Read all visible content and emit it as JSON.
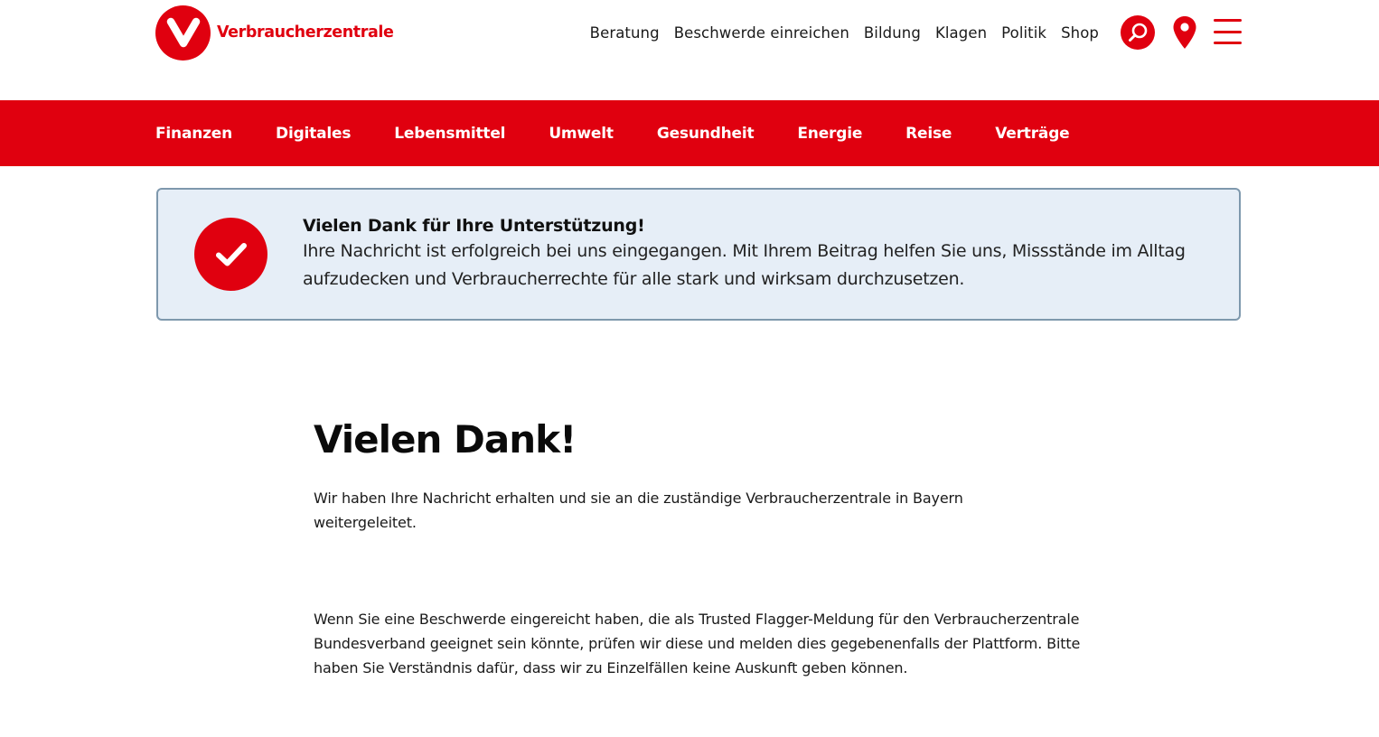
{
  "brand": {
    "name": "Verbraucherzentrale",
    "color": "#e0000f"
  },
  "topnav": {
    "items": [
      {
        "label": "Beratung"
      },
      {
        "label": "Beschwerde einreichen"
      },
      {
        "label": "Bildung"
      },
      {
        "label": "Klagen"
      },
      {
        "label": "Politik"
      },
      {
        "label": "Shop"
      }
    ],
    "icons": [
      "search-icon",
      "location-pin-icon",
      "menu-icon"
    ]
  },
  "catnav": {
    "items": [
      {
        "label": "Finanzen"
      },
      {
        "label": "Digitales"
      },
      {
        "label": "Lebensmittel"
      },
      {
        "label": "Umwelt"
      },
      {
        "label": "Gesundheit"
      },
      {
        "label": "Energie"
      },
      {
        "label": "Reise"
      },
      {
        "label": "Verträge"
      }
    ]
  },
  "notice": {
    "icon": "checkmark-icon",
    "title": "Vielen Dank für Ihre Unterstützung!",
    "body": "Ihre Nachricht ist erfolgreich bei uns eingegangen. Mit Ihrem Beitrag helfen Sie uns, Missstände im Alltag aufzudecken und Verbraucherrechte für alle stark und wirksam durchzusetzen."
  },
  "main": {
    "title": "Vielen Dank!",
    "paragraph1": "Wir haben Ihre Nachricht erhalten und sie an die zuständige Verbraucherzentrale in Bayern weitergeleitet.",
    "paragraph2": "Wenn Sie eine Beschwerde eingereicht haben, die als Trusted Flagger-Meldung für den Verbraucherzentrale Bundesverband geeignet sein könnte, prüfen wir diese und melden dies gegebenenfalls der Plattform. Bitte haben Sie Verständnis dafür, dass wir zu Einzelfällen keine Auskunft geben können."
  }
}
